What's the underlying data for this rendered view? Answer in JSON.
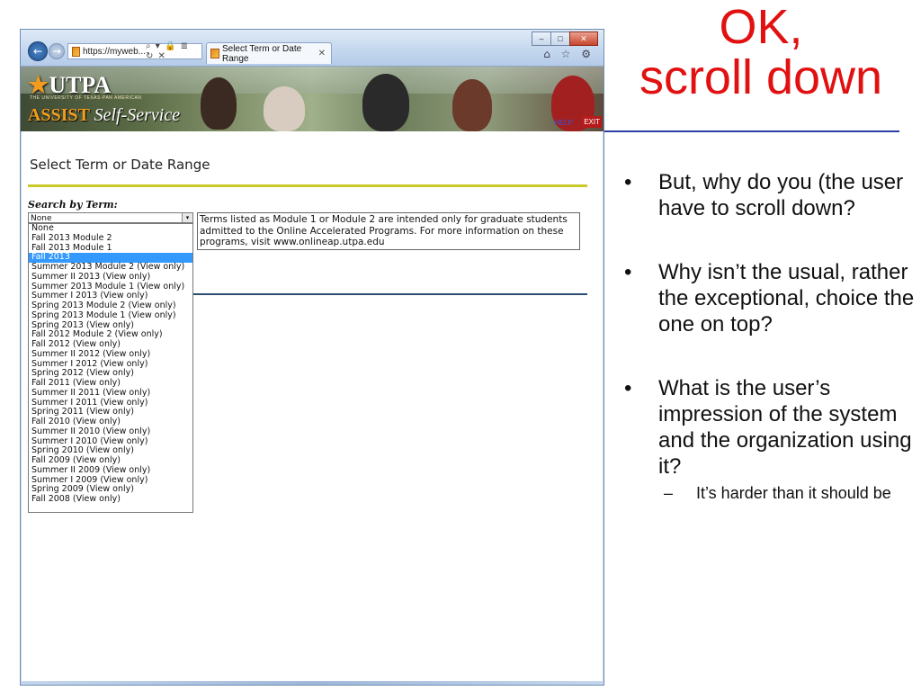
{
  "browser": {
    "address_text": "https://myweb...",
    "address_icons": "⌕ ▾ 🔒 ≣ ↻ ✕",
    "tab_title": "Select Term or Date Range",
    "tab_close": "✕",
    "window_controls": {
      "minimize": "–",
      "maximize": "□",
      "close": "✕"
    },
    "toolbar_icons": "⌂ ☆ ⚙"
  },
  "banner": {
    "logo_main": "UTPA",
    "logo_star": "★",
    "logo_sub": "THE UNIVERSITY OF TEXAS-PAN AMERICAN",
    "logo_assist": "ASSIST",
    "logo_selfservice": "Self-Service",
    "help_link": "HELP",
    "exit_link": "EXIT"
  },
  "page": {
    "title": "Select Term or Date Range",
    "search_label": "Search by Term:",
    "select_value": "None",
    "select_arrow": "▾",
    "term_options": [
      "None",
      "Fall 2013 Module 2",
      "Fall 2013 Module 1",
      "Fall 2013",
      "Summer 2013 Module 2 (View only)",
      "Summer II 2013 (View only)",
      "Summer 2013 Module 1 (View only)",
      "Summer I 2013 (View only)",
      "Spring 2013 Module 2 (View only)",
      "Spring 2013 Module 1 (View only)",
      "Spring 2013 (View only)",
      "Fall 2012 Module 2 (View only)",
      "Fall 2012 (View only)",
      "Summer II 2012 (View only)",
      "Summer I 2012 (View only)",
      "Spring 2012 (View only)",
      "Fall 2011 (View only)",
      "Summer II 2011 (View only)",
      "Summer I 2011 (View only)",
      "Spring 2011 (View only)",
      "Fall 2010 (View only)",
      "Summer II 2010 (View only)",
      "Summer I 2010 (View only)",
      "Spring 2010 (View only)",
      "Fall 2009 (View only)",
      "Summer II 2009 (View only)",
      "Summer I 2009 (View only)",
      "Spring 2009 (View only)",
      "Fall 2008 (View only)"
    ],
    "selected_option": "Fall 2013",
    "info_text": "Terms listed as Module 1 or Module 2 are intended only for graduate students admitted to the Online Accelerated Programs. For more information on these programs, visit www.onlineap.utpa.edu"
  },
  "slide": {
    "title_line1": "OK,",
    "title_line2": "scroll down",
    "bullets": [
      "But, why do you (the user have to scroll down?",
      "Why isn’t the usual, rather the exceptional, choice the one on top?",
      "What is the user’s impression of the system and the organization using it?"
    ],
    "sub_bullet": "It’s harder than it should be"
  },
  "colors": {
    "slide_title": "#e21111",
    "slide_rule": "#2e3ea8",
    "selection": "#3399ff",
    "green_rule": "#c9c92a",
    "blue_rule": "#2b4d6e",
    "utpa_orange": "#f29c1f"
  }
}
